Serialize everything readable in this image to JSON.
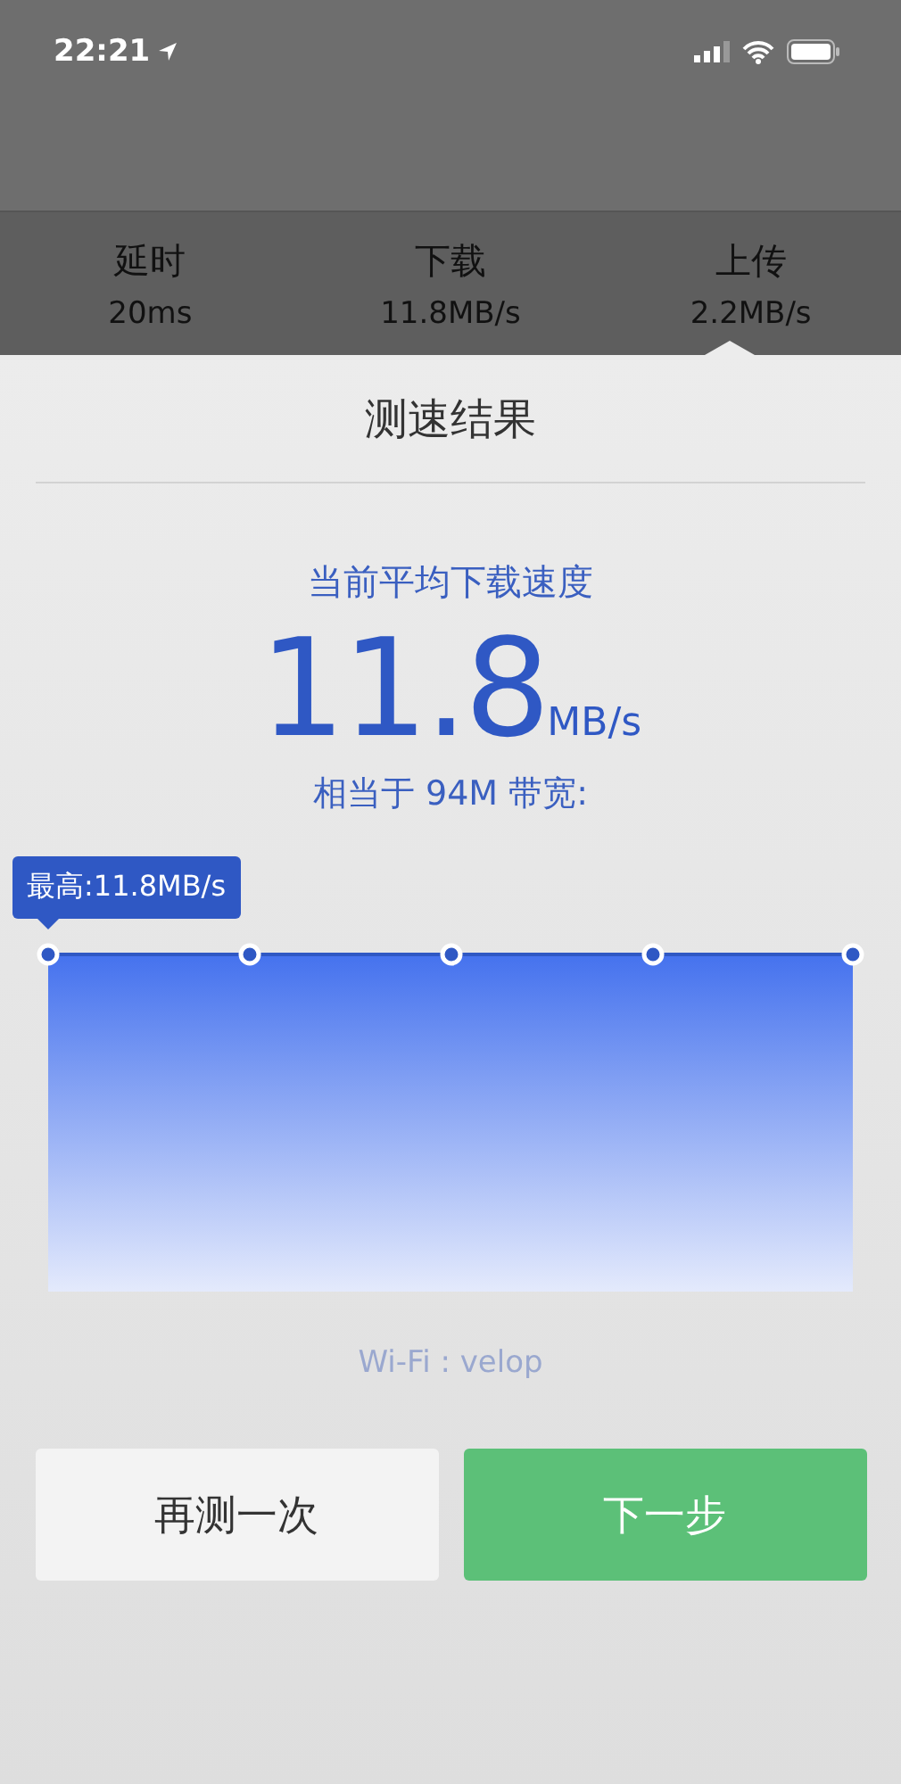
{
  "status_bar": {
    "time": "22:21"
  },
  "stats": [
    {
      "label": "延时",
      "value": "20ms"
    },
    {
      "label": "下载",
      "value": "11.8MB/s"
    },
    {
      "label": "上传",
      "value": "2.2MB/s"
    }
  ],
  "sheet": {
    "title": "测速结果",
    "subtitle": "当前平均下载速度",
    "speed": "11.8",
    "unit": "MB/s",
    "equivalent": "相当于 94M 带宽:"
  },
  "chart": {
    "tooltip": "最高:11.8MB/s"
  },
  "wifi": "Wi-Fi : velop",
  "buttons": [
    {
      "label": "再测一次",
      "kind": "secondary"
    },
    {
      "label": "下一步",
      "kind": "primary"
    }
  ]
}
